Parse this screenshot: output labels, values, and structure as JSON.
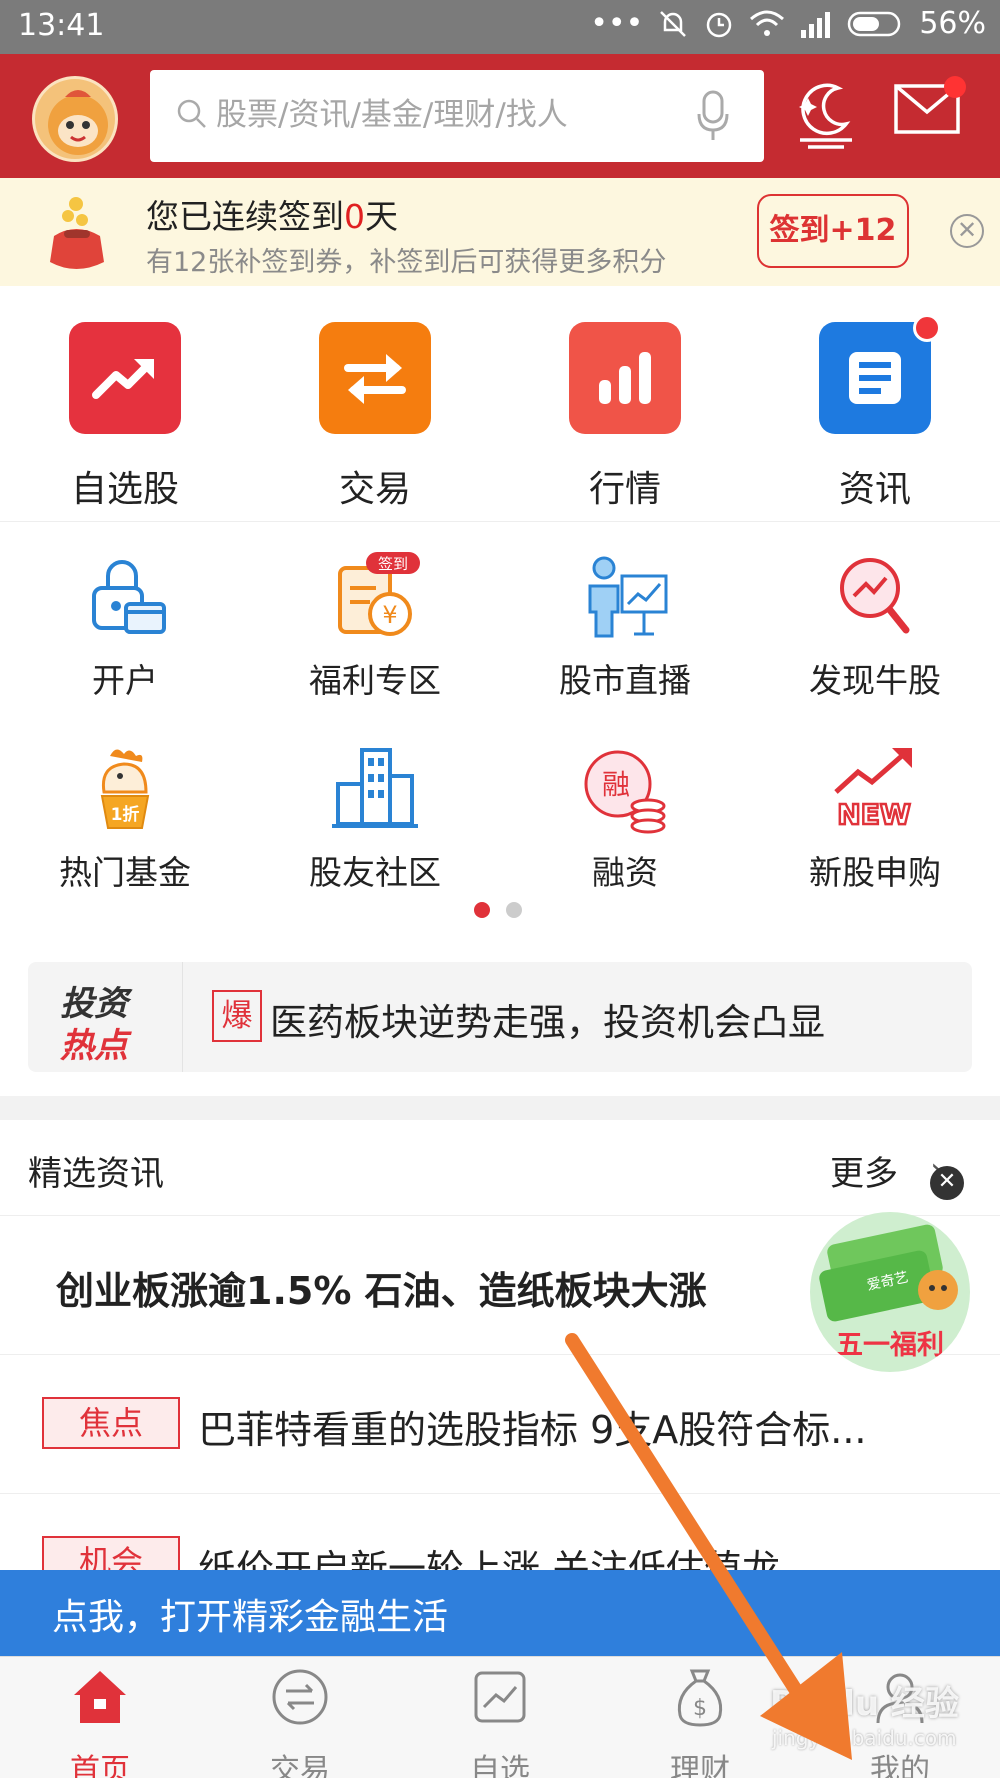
{
  "status_bar": {
    "time": "13:41",
    "battery": "56%"
  },
  "header": {
    "search_placeholder": "股票/资讯/基金/理财/找人"
  },
  "signin": {
    "line1_prefix": "您已连续签到",
    "days": "0",
    "line1_suffix": "天",
    "line2": "有12张补签到券，补签到后可获得更多积分",
    "button": "签到+12"
  },
  "main_grid": [
    {
      "label": "自选股",
      "color": "#e5323e"
    },
    {
      "label": "交易",
      "color": "#f57d0f"
    },
    {
      "label": "行情",
      "color": "#f05448"
    },
    {
      "label": "资讯",
      "color": "#1e7ae0"
    }
  ],
  "sub_grid": [
    {
      "label": "开户",
      "icon": "lock-card-icon"
    },
    {
      "label": "福利专区",
      "icon": "welfare-icon",
      "badge": "签到"
    },
    {
      "label": "股市直播",
      "icon": "live-presenter-icon"
    },
    {
      "label": "发现牛股",
      "icon": "magnifier-chart-icon"
    },
    {
      "label": "热门基金",
      "icon": "rooster-fund-icon",
      "badge": "1折"
    },
    {
      "label": "股友社区",
      "icon": "buildings-icon"
    },
    {
      "label": "融资",
      "icon": "finance-coins-icon",
      "badge": "融"
    },
    {
      "label": "新股申购",
      "icon": "new-stock-icon",
      "badge": "NEW"
    }
  ],
  "hot_banner": {
    "logo_line1": "投资",
    "logo_line2": "热点",
    "tag": "爆",
    "text": "医药板块逆势走强，投资机会凸显"
  },
  "news": {
    "title": "精选资讯",
    "more": "更多",
    "headline": "创业板涨逾1.5% 石油、造纸板块大涨",
    "items": [
      {
        "tag": "焦点",
        "text": "巴菲特看重的选股指标 9支A股符合标..."
      },
      {
        "tag": "机会",
        "text": "纸价开启新一轮上涨 关注低估值龙..."
      }
    ]
  },
  "float_ad": {
    "caption": "五一福利",
    "brand": "爱奇艺"
  },
  "open_banner": "点我，打开精彩金融生活",
  "tabs": [
    {
      "label": "首页",
      "active": true
    },
    {
      "label": "交易"
    },
    {
      "label": "自选"
    },
    {
      "label": "理财"
    },
    {
      "label": "我的"
    }
  ],
  "watermark": {
    "line1": "Baidu 经验",
    "line2": "jingyan.baidu.com"
  },
  "colors": {
    "brand_red": "#c52b31",
    "accent_red": "#e0323a",
    "blue_banner": "#2f7fdc",
    "signin_bg": "#fdf7df",
    "annotation_arrow": "#f07a2e"
  }
}
